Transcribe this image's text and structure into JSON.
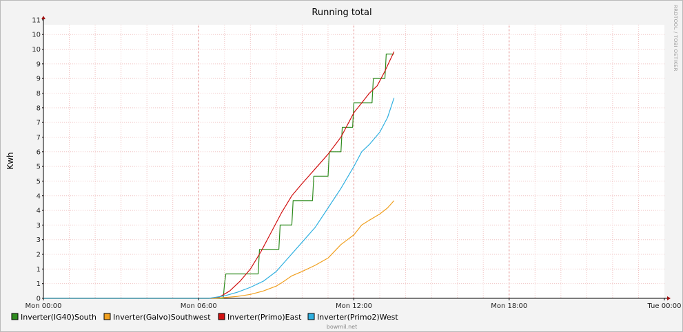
{
  "watermark": "RRDTOOL / TOBI OETIKER",
  "footer": "bowmil.net",
  "chart_data": {
    "type": "line",
    "title": "Running total",
    "ylabel": "Kwh",
    "xlabel": "",
    "xlim_hours": [
      0,
      48
    ],
    "ylim": [
      0,
      11.2
    ],
    "x_ticks": [
      {
        "label": "Mon 00:00",
        "hour": 0
      },
      {
        "label": "Mon 06:00",
        "hour": 6
      },
      {
        "label": "Mon 12:00",
        "hour": 12
      },
      {
        "label": "Mon 18:00",
        "hour": 18
      },
      {
        "label": "Tue 00:00",
        "hour": 24
      }
    ],
    "y_tick_labels": [
      "0",
      "1",
      "1",
      "2",
      "3",
      "3",
      "4",
      "4",
      "5",
      "5",
      "6",
      "7",
      "7",
      "8",
      "8",
      "9",
      "9",
      "10",
      "10",
      "11"
    ],
    "grid": true,
    "legend_position": "bottom-left",
    "series": [
      {
        "name": "Inverter(IG40)South",
        "color": "#2e8b1e",
        "step": true,
        "points": [
          [
            0,
            0
          ],
          [
            6.95,
            0
          ],
          [
            7.0,
            0.6
          ],
          [
            7.05,
            1.0
          ],
          [
            8.3,
            1.0
          ],
          [
            8.35,
            2.0
          ],
          [
            9.1,
            2.0
          ],
          [
            9.15,
            3.0
          ],
          [
            9.6,
            3.0
          ],
          [
            9.65,
            4.0
          ],
          [
            10.4,
            4.0
          ],
          [
            10.45,
            5.0
          ],
          [
            11.0,
            5.0
          ],
          [
            11.05,
            6.0
          ],
          [
            11.5,
            6.0
          ],
          [
            11.55,
            7.0
          ],
          [
            11.95,
            7.0
          ],
          [
            12.0,
            8.0
          ],
          [
            12.7,
            8.0
          ],
          [
            12.75,
            9.0
          ],
          [
            13.2,
            9.0
          ],
          [
            13.25,
            10.0
          ],
          [
            13.55,
            10.0
          ]
        ]
      },
      {
        "name": "Inverter(Galvo)Southwest",
        "color": "#f0a020",
        "step": false,
        "points": [
          [
            0,
            0
          ],
          [
            6.6,
            0
          ],
          [
            7.0,
            0.03
          ],
          [
            7.5,
            0.08
          ],
          [
            8.0,
            0.16
          ],
          [
            8.5,
            0.3
          ],
          [
            9.0,
            0.5
          ],
          [
            9.3,
            0.7
          ],
          [
            9.6,
            0.92
          ],
          [
            10.0,
            1.1
          ],
          [
            10.5,
            1.35
          ],
          [
            11.0,
            1.65
          ],
          [
            11.5,
            2.2
          ],
          [
            12.0,
            2.6
          ],
          [
            12.3,
            3.0
          ],
          [
            12.6,
            3.2
          ],
          [
            13.0,
            3.45
          ],
          [
            13.3,
            3.7
          ],
          [
            13.55,
            4.0
          ]
        ]
      },
      {
        "name": "Inverter(Primo)East",
        "color": "#d01010",
        "step": false,
        "points": [
          [
            0,
            0
          ],
          [
            6.4,
            0
          ],
          [
            6.8,
            0.05
          ],
          [
            7.2,
            0.3
          ],
          [
            7.6,
            0.7
          ],
          [
            8.0,
            1.2
          ],
          [
            8.4,
            1.9
          ],
          [
            8.8,
            2.7
          ],
          [
            9.2,
            3.5
          ],
          [
            9.6,
            4.2
          ],
          [
            10.0,
            4.7
          ],
          [
            10.5,
            5.3
          ],
          [
            11.0,
            5.9
          ],
          [
            11.5,
            6.6
          ],
          [
            12.0,
            7.6
          ],
          [
            12.3,
            8.0
          ],
          [
            12.6,
            8.4
          ],
          [
            12.9,
            8.7
          ],
          [
            13.2,
            9.3
          ],
          [
            13.55,
            10.1
          ]
        ]
      },
      {
        "name": "Inverter(Primo2)West",
        "color": "#30b0e0",
        "step": false,
        "points": [
          [
            0,
            0
          ],
          [
            6.4,
            0
          ],
          [
            7.0,
            0.1
          ],
          [
            7.5,
            0.25
          ],
          [
            8.0,
            0.45
          ],
          [
            8.5,
            0.7
          ],
          [
            9.0,
            1.1
          ],
          [
            9.5,
            1.7
          ],
          [
            10.0,
            2.3
          ],
          [
            10.5,
            2.9
          ],
          [
            11.0,
            3.7
          ],
          [
            11.5,
            4.5
          ],
          [
            12.0,
            5.4
          ],
          [
            12.3,
            6.0
          ],
          [
            12.6,
            6.3
          ],
          [
            13.0,
            6.8
          ],
          [
            13.3,
            7.4
          ],
          [
            13.55,
            8.2
          ]
        ]
      }
    ]
  }
}
